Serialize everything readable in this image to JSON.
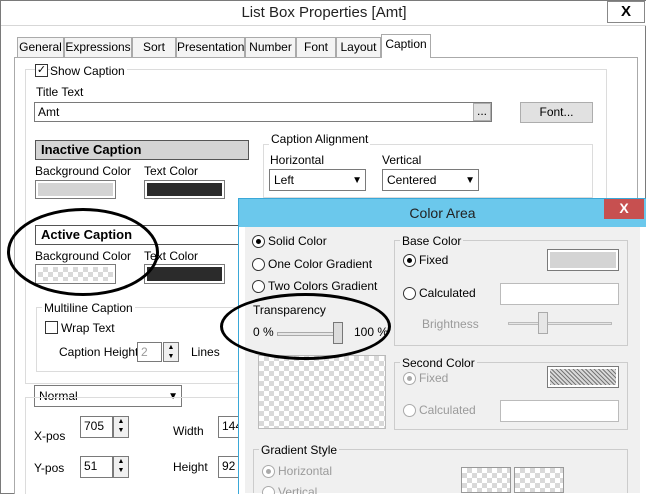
{
  "window": {
    "title": "List Box Properties [Amt]",
    "close_label": "X"
  },
  "tabs": [
    {
      "label": "General"
    },
    {
      "label": "Expressions"
    },
    {
      "label": "Sort"
    },
    {
      "label": "Presentation"
    },
    {
      "label": "Number"
    },
    {
      "label": "Font"
    },
    {
      "label": "Layout"
    },
    {
      "label": "Caption"
    }
  ],
  "active_tab": "Caption",
  "caption": {
    "show_caption_label": "Show Caption",
    "show_caption_checked": true,
    "title_text_label": "Title Text",
    "title_text_value": "Amt",
    "ellipsis_label": "...",
    "font_button_label": "Font...",
    "inactive_caption_label": "Inactive Caption",
    "inactive_bg_label": "Background Color",
    "inactive_text_label": "Text Color",
    "inactive_bg_color": "#d4d4d4",
    "inactive_text_color": "#2b2b2b",
    "active_caption_label": "Active Caption",
    "active_bg_label": "Background Color",
    "active_text_label": "Text Color",
    "active_text_color": "#2b2b2b",
    "alignment_label": "Caption Alignment",
    "horizontal_label": "Horizontal",
    "horizontal_value": "Left",
    "vertical_label": "Vertical",
    "vertical_value": "Centered",
    "multiline_label": "Multiline Caption",
    "wrap_text_label": "Wrap Text",
    "caption_height_label": "Caption Height",
    "caption_height_value": "2",
    "lines_label": "Lines",
    "state_value": "Normal",
    "xpos_label": "X-pos",
    "xpos_value": "705",
    "ypos_label": "Y-pos",
    "ypos_value": "51",
    "width_label": "Width",
    "width_value": "144",
    "height_label": "Height",
    "height_value": "92"
  },
  "color_area": {
    "title": "Color Area",
    "close_label": "X",
    "solid_color_label": "Solid Color",
    "one_color_gradient_label": "One Color Gradient",
    "two_colors_gradient_label": "Two Colors Gradient",
    "transparency_label": "Transparency",
    "transparency_min": "0 %",
    "transparency_max": "100 %",
    "transparency_level": 1.0,
    "base_color_label": "Base Color",
    "fixed_label": "Fixed",
    "calculated_label": "Calculated",
    "brightness_label": "Brightness",
    "base_color": "#d4d4d4",
    "second_color_label": "Second Color",
    "second_fixed_label": "Fixed",
    "second_calculated_label": "Calculated",
    "gradient_style_label": "Gradient Style",
    "horizontal_label": "Horizontal",
    "vertical_label": "Vertical"
  },
  "colors": {
    "dialog_title_bar": "#6bc8ec",
    "close_red": "#c75050"
  }
}
